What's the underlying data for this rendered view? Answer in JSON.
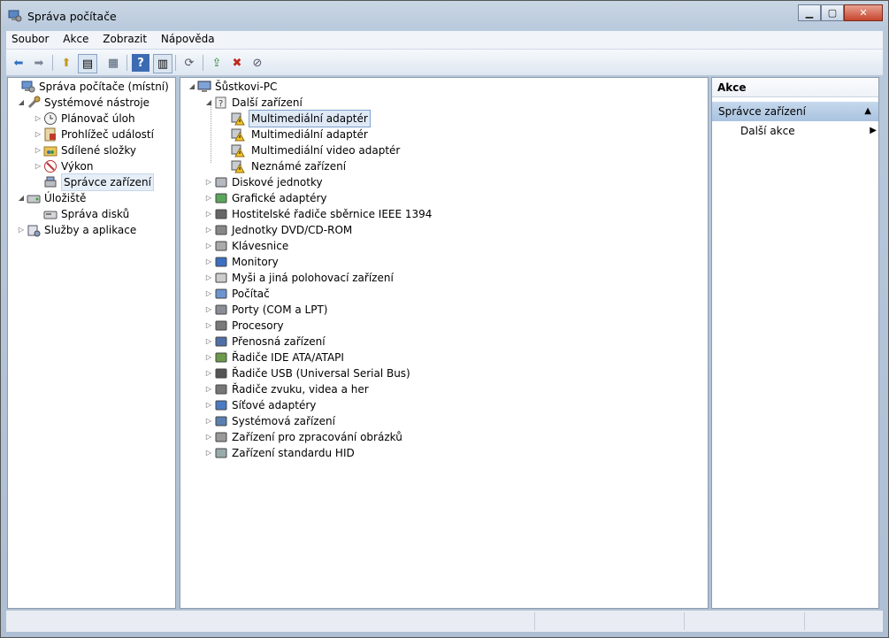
{
  "window": {
    "title": "Správa počítače"
  },
  "menu": [
    "Soubor",
    "Akce",
    "Zobrazit",
    "Nápověda"
  ],
  "left_tree": [
    {
      "label": "Správa počítače (místní)",
      "indent": 0,
      "arrow": "",
      "icon": "computer-management-icon"
    },
    {
      "label": "Systémové nástroje",
      "indent": 1,
      "arrow": "◢",
      "icon": "system-tools-icon"
    },
    {
      "label": "Plánovač úloh",
      "indent": 2,
      "arrow": "▷",
      "icon": "task-scheduler-icon"
    },
    {
      "label": "Prohlížeč událostí",
      "indent": 2,
      "arrow": "▷",
      "icon": "event-viewer-icon"
    },
    {
      "label": "Sdílené složky",
      "indent": 2,
      "arrow": "▷",
      "icon": "shared-folders-icon"
    },
    {
      "label": "Výkon",
      "indent": 2,
      "arrow": "▷",
      "icon": "performance-icon"
    },
    {
      "label": "Správce zařízení",
      "indent": 2,
      "arrow": "",
      "icon": "device-manager-icon",
      "selected": true
    },
    {
      "label": "Úložiště",
      "indent": 1,
      "arrow": "◢",
      "icon": "storage-icon"
    },
    {
      "label": "Správa disků",
      "indent": 2,
      "arrow": "",
      "icon": "disk-management-icon"
    },
    {
      "label": "Služby a aplikace",
      "indent": 1,
      "arrow": "▷",
      "icon": "services-applications-icon"
    }
  ],
  "device_tree": {
    "root": "Šůstkovi-PC",
    "other_devices": {
      "label": "Další zařízení",
      "children": [
        "Multimediální adaptér",
        "Multimediální adaptér",
        "Multimediální video adaptér",
        "Neznámé zařízení"
      ]
    },
    "categories": [
      "Diskové jednotky",
      "Grafické adaptéry",
      "Hostitelské řadiče sběrnice IEEE 1394",
      "Jednotky DVD/CD-ROM",
      "Klávesnice",
      "Monitory",
      "Myši a jiná polohovací zařízení",
      "Počítač",
      "Porty (COM a LPT)",
      "Procesory",
      "Přenosná zařízení",
      "Řadiče IDE ATA/ATAPI",
      "Řadiče USB (Universal Serial Bus)",
      "Řadiče zvuku, videa a her",
      "Síťové adaptéry",
      "Systémová zařízení",
      "Zařízení pro zpracování obrázků",
      "Zařízení standardu HID"
    ]
  },
  "actions": {
    "header": "Akce",
    "section": "Správce zařízení",
    "item": "Další akce"
  },
  "colors": {
    "selection": "#dfe9f6",
    "action_section": "#b6cce6",
    "warning": "#f3c224"
  }
}
